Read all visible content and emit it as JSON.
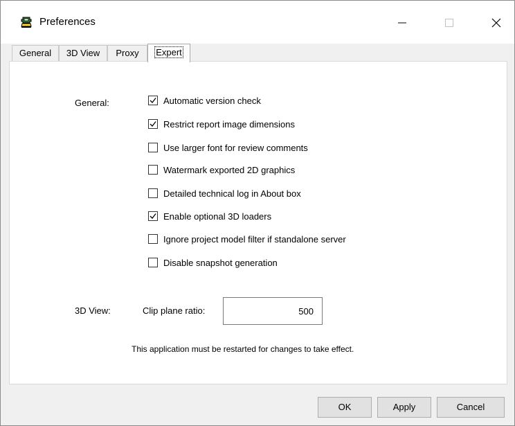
{
  "window": {
    "title": "Preferences",
    "app_icon": "app-logo-icon"
  },
  "tabs": [
    {
      "label": "General",
      "active": false
    },
    {
      "label": "3D View",
      "active": false
    },
    {
      "label": "Proxy",
      "active": false
    },
    {
      "label": "Expert",
      "active": true
    }
  ],
  "general": {
    "label": "General:",
    "options": [
      {
        "label": "Automatic version check",
        "checked": true
      },
      {
        "label": "Restrict report image dimensions",
        "checked": true
      },
      {
        "label": "Use larger font for review comments",
        "checked": false
      },
      {
        "label": "Watermark exported 2D graphics",
        "checked": false
      },
      {
        "label": "Detailed technical log in About box",
        "checked": false
      },
      {
        "label": "Enable optional 3D loaders",
        "checked": true
      },
      {
        "label": "Ignore project model filter if standalone server",
        "checked": false
      },
      {
        "label": "Disable snapshot generation",
        "checked": false
      }
    ]
  },
  "view3d": {
    "label": "3D View:",
    "clip_label": "Clip plane ratio:",
    "clip_value": "500"
  },
  "notice": "This application must be restarted for changes to take effect.",
  "buttons": {
    "ok": "OK",
    "apply": "Apply",
    "cancel": "Cancel"
  }
}
